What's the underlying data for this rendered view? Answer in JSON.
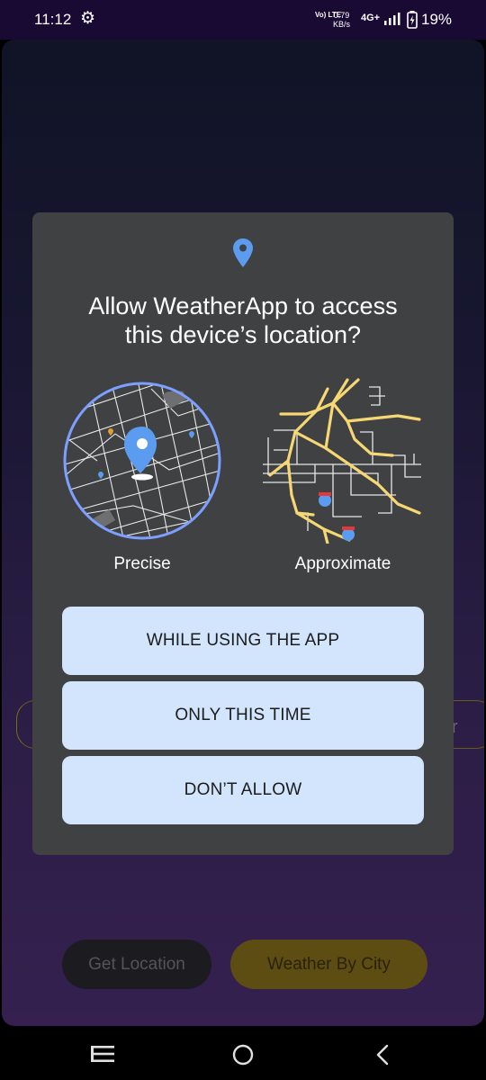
{
  "status_bar": {
    "time": "11:12",
    "volte": "Vo) LTE",
    "speed_value": "0.79",
    "speed_unit": "KB/s",
    "network": "4G+",
    "battery_percent": "19%"
  },
  "background": {
    "right_pill_text": "r",
    "get_location_label": "Get Location",
    "weather_by_city_label": "Weather By City"
  },
  "dialog": {
    "title_line1": "Allow WeatherApp to access",
    "title_line2": "this device’s location?",
    "precise_label": "Precise",
    "approximate_label": "Approximate",
    "while_using_label": "WHILE USING THE APP",
    "only_this_time_label": "ONLY THIS TIME",
    "dont_allow_label": "DON’T ALLOW"
  },
  "colors": {
    "accent_pin": "#5b9cf0",
    "map_ring": "#7d9fff",
    "road": "#f7d774",
    "button_bg": "#d2e5fd",
    "dialog_bg": "#3f4142"
  },
  "icons": [
    "gear-icon",
    "signal-icon",
    "battery-icon",
    "location-pin-icon",
    "recents-icon",
    "home-icon",
    "back-icon"
  ]
}
